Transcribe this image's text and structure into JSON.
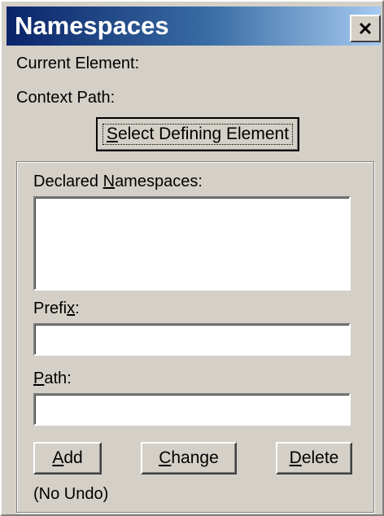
{
  "window": {
    "title": "Namespaces",
    "close_icon": "close-icon"
  },
  "info": {
    "current_element_label": "Current Element:",
    "context_path_label": "Context Path:"
  },
  "select_defining_button": {
    "pre": "",
    "mnemonic": "S",
    "post": "elect Defining Element"
  },
  "group": {
    "declared_label_pre": "Declared ",
    "declared_label_mnemonic": "N",
    "declared_label_post": "amespaces:",
    "prefix_label_pre": "Prefi",
    "prefix_label_mnemonic": "x",
    "prefix_label_post": ":",
    "prefix_value": "",
    "path_label_pre": "",
    "path_label_mnemonic": "P",
    "path_label_post": "ath:",
    "path_value": ""
  },
  "actions": {
    "add_mnemonic": "A",
    "add_rest": "dd",
    "change_mnemonic": "C",
    "change_rest": "hange",
    "delete_mnemonic": "D",
    "delete_rest": "elete",
    "no_undo_note": "(No Undo)"
  }
}
